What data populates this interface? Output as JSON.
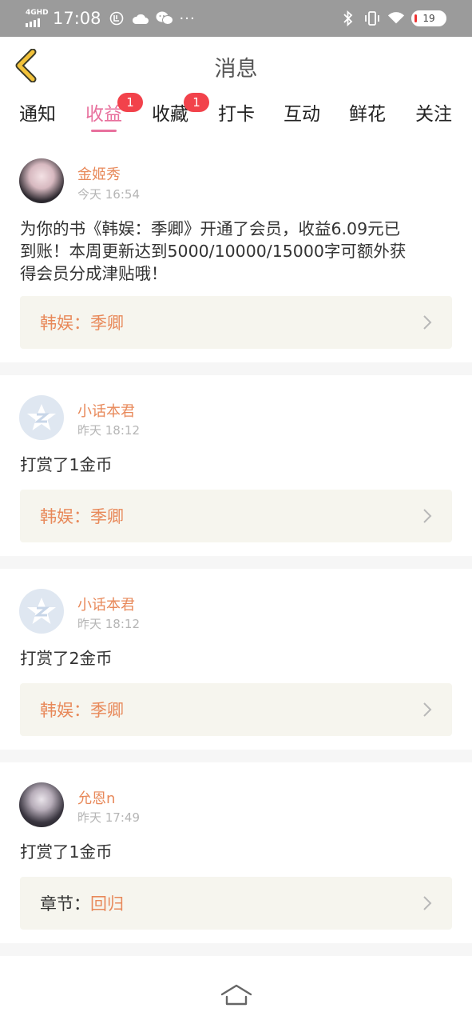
{
  "status_bar": {
    "network": "4GHD",
    "time": "17:08",
    "battery": "19",
    "icons": [
      "data-saver-icon",
      "cloud-icon",
      "wechat-icon",
      "more-dots-icon",
      "bluetooth-icon",
      "vibrate-icon",
      "wifi-icon",
      "battery-icon"
    ]
  },
  "header": {
    "title": "消息",
    "back_icon": "chevron-left-icon"
  },
  "tabs": [
    {
      "label": "通知",
      "badge": null,
      "active": false
    },
    {
      "label": "收益",
      "badge": "1",
      "active": true
    },
    {
      "label": "收藏",
      "badge": "1",
      "active": false
    },
    {
      "label": "打卡",
      "badge": null,
      "active": false
    },
    {
      "label": "互动",
      "badge": null,
      "active": false
    },
    {
      "label": "鲜花",
      "badge": null,
      "active": false
    },
    {
      "label": "关注",
      "badge": null,
      "active": false
    }
  ],
  "messages": [
    {
      "user": "金姬秀",
      "time": "今天 16:54",
      "text_lines": [
        "为你的书《韩娱：季卿》开通了会员，收益6.09元已",
        "到账！本周更新达到5000/10000/15000字可额外获",
        "得会员分成津贴哦！"
      ],
      "link_prefix": "",
      "link_text": "韩娱：季卿"
    },
    {
      "user": "小话本君",
      "time": "昨天 18:12",
      "text_lines": [
        "打赏了1金币"
      ],
      "link_prefix": "",
      "link_text": "韩娱：季卿"
    },
    {
      "user": "小话本君",
      "time": "昨天 18:12",
      "text_lines": [
        "打赏了2金币"
      ],
      "link_prefix": "",
      "link_text": "韩娱：季卿"
    },
    {
      "user": "允恩n",
      "time": "昨天 17:49",
      "text_lines": [
        "打赏了1金币"
      ],
      "link_prefix": "章节：",
      "link_text": "回归"
    }
  ],
  "colors": {
    "accent_pink": "#e8709d",
    "name_orange": "#e8895a",
    "badge_red": "#f2424b",
    "link_bg": "#f6f5ee",
    "back_yellow": "#f2c23a"
  },
  "bottom_nav": {
    "home_icon": "home-icon"
  }
}
